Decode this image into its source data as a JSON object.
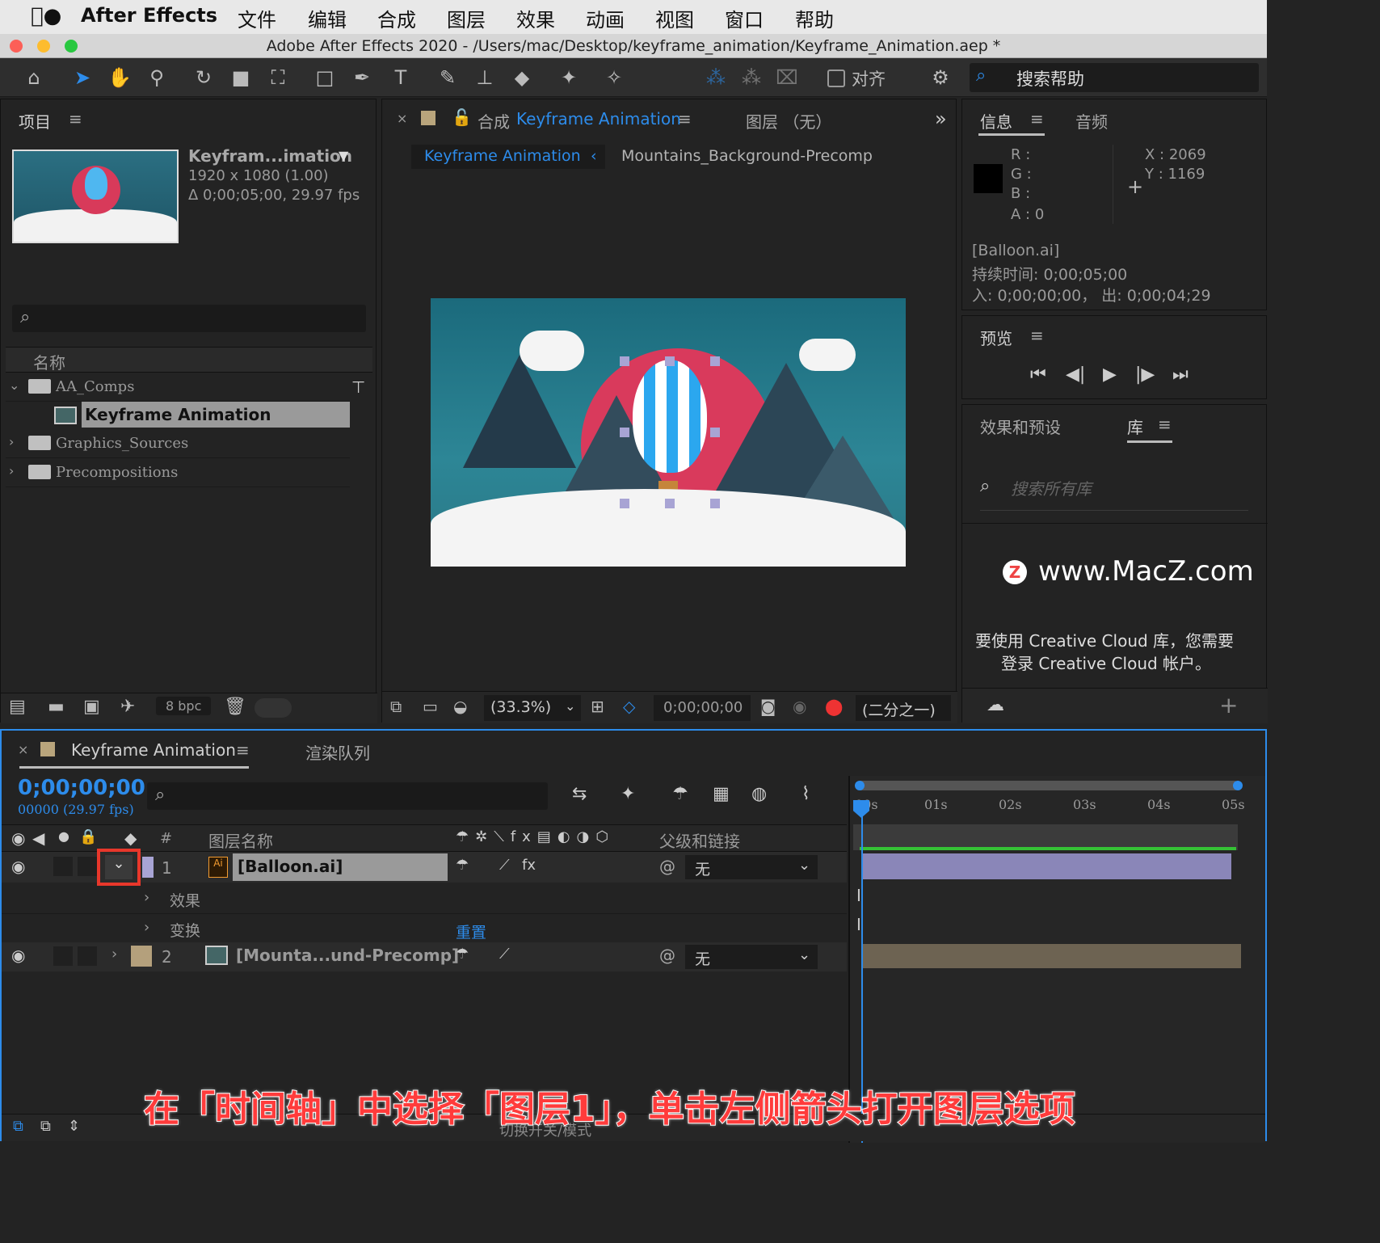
{
  "menubar": {
    "apple": "",
    "app": "After Effects",
    "items": [
      "文件",
      "编辑",
      "合成",
      "图层",
      "效果",
      "动画",
      "视图",
      "窗口",
      "帮助"
    ]
  },
  "window": {
    "title": "Adobe After Effects 2020 - /Users/mac/Desktop/keyframe_animation/Keyframe_Animation.aep *"
  },
  "toolbar": {
    "align_label": "对齐",
    "search_help": "搜索帮助"
  },
  "project": {
    "tab": "项目",
    "name": "Keyfram...imation",
    "dims": "1920 x 1080 (1.00)",
    "duration": "Δ 0;00;05;00, 29.97 fps",
    "col_name": "名称",
    "bpc": "8 bpc",
    "items": [
      {
        "label": "AA_Comps",
        "type": "folder"
      },
      {
        "label": "Keyframe Animation",
        "type": "comp"
      },
      {
        "label": "Graphics_Sources",
        "type": "folder"
      },
      {
        "label": "Precompositions",
        "type": "folder"
      }
    ]
  },
  "composition": {
    "tab_prefix": "合成",
    "tab_name": "Keyframe Animation",
    "layer_tab": "图层 （无）",
    "breadcrumb_active": "Keyframe Animation",
    "breadcrumb_next": "Mountains_Background-Precomp",
    "zoom": "(33.3%)",
    "timecode": "0;00;00;00",
    "resolution": "(二分之一)"
  },
  "info": {
    "tab": "信息",
    "audio_tab": "音频",
    "r": "R :",
    "g": "G :",
    "b": "B :",
    "a": "A :  0",
    "x": "X :  2069",
    "y": "Y :  1169",
    "layer": "[Balloon.ai]",
    "duration": "持续时间: 0;00;05;00",
    "inout": "入: 0;00;00;00， 出: 0;00;04;29"
  },
  "preview": {
    "tab": "预览"
  },
  "library": {
    "effects_tab": "效果和预设",
    "lib_tab": "库",
    "search_placeholder": "搜索所有库",
    "watermark": "www.MacZ.com",
    "message_line1": "要使用 Creative Cloud 库，您需要",
    "message_line2": "登录 Creative Cloud 帐户。"
  },
  "timeline": {
    "tab": "Keyframe Animation",
    "render_tab": "渲染队列",
    "timecode": "0;00;00;00",
    "fps": "00000 (29.97 fps)",
    "col_num": "#",
    "col_layer": "图层名称",
    "col_parent": "父级和链接",
    "ruler": [
      "00s",
      "01s",
      "02s",
      "03s",
      "04s",
      "05s"
    ],
    "layers": [
      {
        "num": "1",
        "name": "[Balloon.ai]",
        "parent": "无"
      },
      {
        "num": "2",
        "name": "[Mounta...und-Precomp]",
        "parent": "无"
      }
    ],
    "sub_effects": "效果",
    "sub_transform": "变换",
    "reset": "重置",
    "footer": "切换开关/模式"
  },
  "caption": "在「时间轴」中选择「图层1」，单击左侧箭头打开图层选项",
  "colors": {
    "accent": "#2d8ceb",
    "highlight_box": "#e8372b",
    "layer1_color": "#a8a4d4",
    "layer2_color": "#b4a07c",
    "balloon_track": "#8a86b8",
    "mountain_track": "#6d6352",
    "green_bar": "#35c235"
  }
}
